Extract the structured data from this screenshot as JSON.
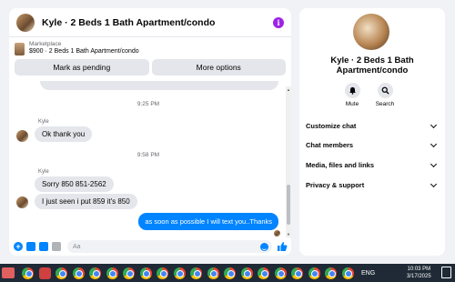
{
  "chat": {
    "title": "Kyle · 2 Beds 1 Bath Apartment/condo",
    "info_icon": "i",
    "marketplace": {
      "label": "Marketplace",
      "listing": "$900 · 2 Beds 1 Bath Apartment/condo",
      "pending_button": "Mark as pending",
      "more_button": "More options"
    },
    "messages": {
      "time1": "9:25 PM",
      "sender1": "Kyle",
      "msg1": "Ok thank you",
      "time2": "9:58 PM",
      "sender2": "Kyle",
      "msg2": "Sorry 850 851-2562",
      "msg3": "I just seen i put 859 it's 850",
      "outgoing": "as soon as possible I will text you..Thanks"
    },
    "composer": {
      "placeholder": "Aa"
    }
  },
  "info_panel": {
    "name": "Kyle · 2 Beds 1 Bath Apartment/condo",
    "mute_label": "Mute",
    "search_label": "Search",
    "rows": [
      "Customize chat",
      "Chat members",
      "Media, files and links",
      "Privacy & support"
    ]
  },
  "taskbar": {
    "time": "10:03 PM",
    "date": "3/17/2025",
    "system_text": "ENG"
  },
  "colors": {
    "accent": "#0084ff",
    "info_purple": "#9d22e8",
    "taskbar": "#1f2a36"
  }
}
